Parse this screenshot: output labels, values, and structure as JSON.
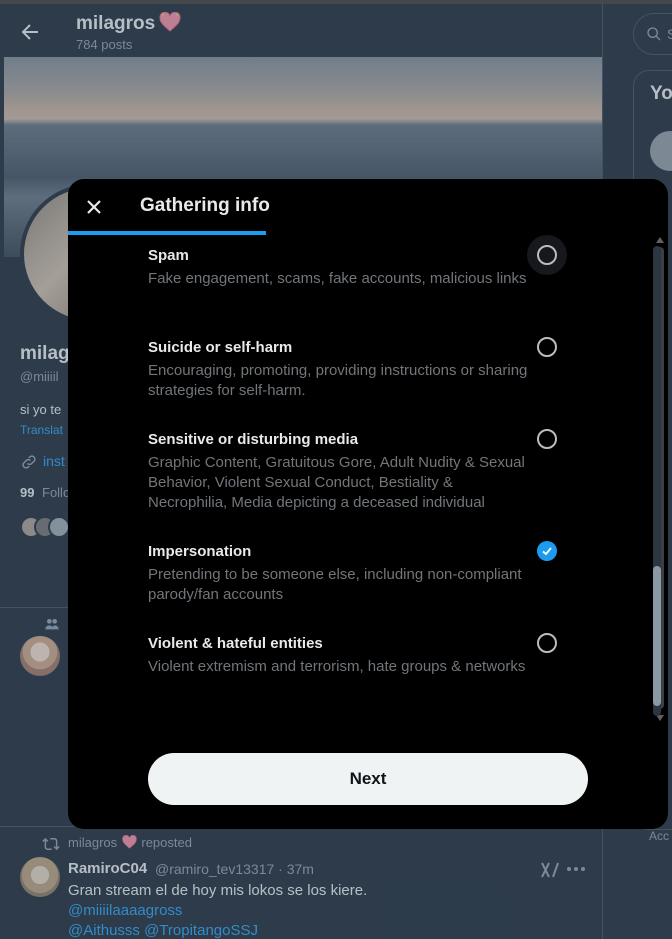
{
  "header": {
    "name": "milagros",
    "posts": "784 posts"
  },
  "profile": {
    "name_partial": "milag",
    "handle_partial": "@miiiil",
    "bio_partial": "si yo te",
    "translate_partial": "Translat",
    "link_partial": "inst",
    "following_count": "99",
    "following_label_partial": "Follo"
  },
  "tweet": {
    "repost_user": "milagros",
    "repost_suffix": "reposted",
    "author_name": "RamiroC04",
    "author_meta": "@ramiro_tev13317 · 37m",
    "text": "Gran stream el de hoy mis lokos se los kiere.",
    "mention_line1": "@miiiilaaaagross",
    "mention_line2": "@Aithusss @TropitangoSSJ"
  },
  "right_column": {
    "search_placeholder_partial": "S",
    "card_title_partial": "Yo",
    "footer_partial": "Acc"
  },
  "modal": {
    "title": "Gathering info",
    "progress_fraction": 0.33,
    "next_label": "Next",
    "options": [
      {
        "title": "Spam",
        "description": "Fake engagement, scams, fake accounts, malicious links",
        "checked": false,
        "hovered": true
      },
      {
        "title": "Suicide or self-harm",
        "description": "Encouraging, promoting, providing instructions or sharing strategies for self-harm.",
        "checked": false,
        "hovered": false
      },
      {
        "title": "Sensitive or disturbing media",
        "description": "Graphic Content, Gratuitous Gore, Adult Nudity & Sexual Behavior, Violent Sexual Conduct, Bestiality & Necrophilia, Media depicting a deceased individual",
        "checked": false,
        "hovered": false
      },
      {
        "title": "Impersonation",
        "description": "Pretending to be someone else, including non-compliant parody/fan accounts",
        "checked": true,
        "hovered": false
      },
      {
        "title": "Violent & hateful entities",
        "description": "Violent extremism and terrorism, hate groups & networks",
        "checked": false,
        "hovered": false
      }
    ]
  },
  "colors": {
    "accent": "#1d9bf0",
    "background": "#15202b",
    "modal_bg": "#000000",
    "text_primary": "#e7e9ea",
    "text_secondary": "#71767b",
    "heart": "#f4889c"
  }
}
